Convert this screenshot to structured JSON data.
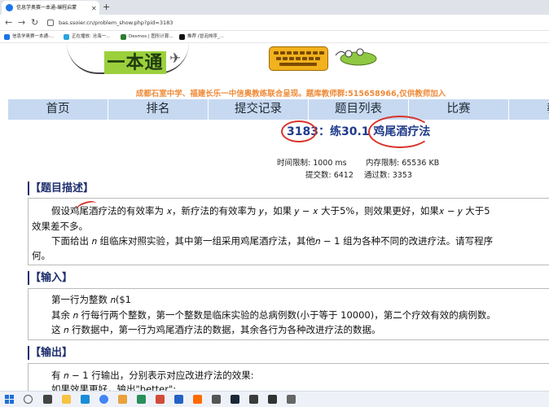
{
  "browser": {
    "tab_title": "信息学奥赛一本通-编程启蒙",
    "url": "bas.ssoier.cn/problem_show.php?pid=3183",
    "bookmarks": [
      "信息学奥赛一本通-...",
      "正在播放: 沧海一...",
      "Desmos | 图形计算...",
      "推荐 (冒泡排序_..."
    ]
  },
  "site": {
    "logo_text": "一本通",
    "tagline": "成都石室中学、福建长乐一中信奥教练联合呈现。题库教师群:515658966,仅供教师加入"
  },
  "menu": [
    "首页",
    "排名",
    "提交记录",
    "题目列表",
    "比赛",
    "教师"
  ],
  "problem": {
    "title": "3183：练30.1 鸡尾酒疗法",
    "time_limit": "时间限制: 1000 ms",
    "memory_limit": "内存限制: 65536 KB",
    "submissions": "提交数: 6412",
    "accepted": "通过数: 3353"
  },
  "sections": {
    "desc_head": "【题目描述】",
    "desc_l1": "假设鸡尾酒疗法的有效率为 𝑥，新疗法的有效率为 𝑦，如果 𝑦 − 𝑥 大于5%，则效果更好，如果𝑥 − 𝑦 大于5",
    "desc_l2": "效果差不多。",
    "desc_l3": "下面给出 𝑛 组临床对照实验，其中第一组采用鸡尾酒疗法，其他𝑛 − 1 组为各种不同的改进疗法。请写程序",
    "desc_l4": "何。",
    "input_head": "【输入】",
    "input_l1": "第一行为整数 𝑛($1",
    "input_l2": "其余 𝑛 行每行两个整数，第一个整数是临床实验的总病例数(小于等于 10000)，第二个疗效有效的病例数。",
    "input_l3": "这 𝑛 行数据中，第一行为鸡尾酒疗法的数据，其余各行为各种改进疗法的数据。",
    "output_head": "【输出】",
    "output_l1": "有 𝑛 − 1 行输出，分别表示对应改进疗法的效果:",
    "output_l2": "如果效果更好，输出\"better\";"
  },
  "colors": {
    "menu_bg": "#c7d9f1",
    "title": "#1f3a8a",
    "tagline": "#ef8b3a",
    "logo_bg": "#9bd03c",
    "annotation": "#d8332a"
  }
}
